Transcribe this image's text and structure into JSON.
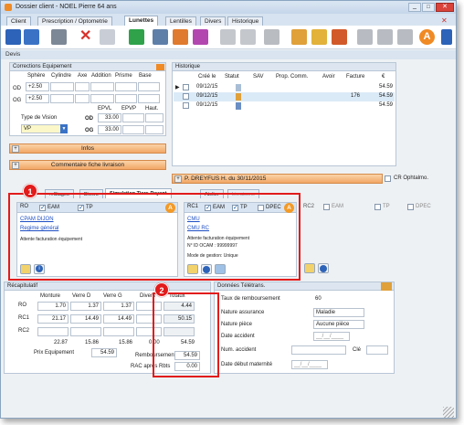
{
  "window": {
    "title": "Dossier client - NOEL Pierre 64 ans"
  },
  "tabs": [
    "Client",
    "Prescription / Optometrie",
    "Lunettes",
    "Lentilles",
    "Divers",
    "Historique"
  ],
  "devis_label": "Devis",
  "corrections": {
    "title": "Corrections Equipement",
    "headers": [
      "Sphère",
      "Cylindre",
      "Axe",
      "Addition",
      "Prisme",
      "Base"
    ],
    "rows": [
      {
        "eye": "OD",
        "sphere": "+2.50"
      },
      {
        "eye": "OG",
        "sphere": "+2.50"
      }
    ],
    "epvl_label": "EPVL",
    "epvp_label": "EPVP",
    "haut_label": "Haut.",
    "type_vision_label": "Type de Vision",
    "type_vision_value": "VP",
    "od_label": "OD",
    "og_label": "OG",
    "od_epvl": "33.00",
    "og_epvl": "33.00"
  },
  "buttons": {
    "infos": "Infos",
    "commentaire": "Commentaire fiche livraison",
    "dreyfus": "P. DREYFUS H. du 30/11/2015",
    "cr_label": "CR Ophtalmo."
  },
  "historique": {
    "title": "Historique",
    "headers": [
      "Créé le",
      "Statut",
      "SAV",
      "Prop. Comm.",
      "Avoir",
      "Facture",
      "€"
    ],
    "rows": [
      {
        "date": "09/12/15",
        "facture": "",
        "amount": "54.59"
      },
      {
        "date": "09/12/15",
        "facture": "176",
        "amount": "54.59"
      },
      {
        "date": "09/12/15",
        "facture": "",
        "amount": "54.59"
      }
    ]
  },
  "subtabs": [
    "...Stages",
    "Divers",
    "Simulation Tiers-Payant",
    "Atelier",
    "Livraisons"
  ],
  "ro": {
    "label": "RO",
    "eam": "EAM",
    "tp": "TP",
    "caisse": "CPAM DIJON",
    "regime": "Regime général",
    "attente": "Attente facturation équipement"
  },
  "rc1": {
    "label": "RC1",
    "eam": "EAM",
    "tp": "TP",
    "dpec": "DPEC",
    "name1": "CMU",
    "name2": "CMU RC",
    "attente": "Attente facturation équipement",
    "ocam": "N° ID OCAM : 99999997",
    "gestion": "Mode de gestion: Unique"
  },
  "rc2": {
    "label": "RC2",
    "eam": "EAM",
    "tp": "TP",
    "dpec": "DPEC"
  },
  "recap": {
    "title": "Récapitulatif",
    "headers": [
      "Monture",
      "Verre D",
      "Verre G",
      "Divers",
      "Totaux"
    ],
    "rows": [
      {
        "label": "RO",
        "values": [
          "1.70",
          "1.37",
          "1.37",
          "",
          "4.44"
        ]
      },
      {
        "label": "RC1",
        "values": [
          "21.17",
          "14.49",
          "14.49",
          "",
          "50.15"
        ]
      },
      {
        "label": "RC2",
        "values": [
          "",
          "",
          "",
          "",
          ""
        ]
      }
    ],
    "totals": [
      "22.87",
      "15.86",
      "15.86",
      "0.00",
      "54.59"
    ],
    "prix_label": "Prix Equipement",
    "prix_value": "54.59",
    "remb_label": "Remboursement estimé",
    "remb_value": "54.59",
    "rac_label": "RAC après Rbts",
    "rac_value": "0.00"
  },
  "teletrans": {
    "title": "Données Télétrans.",
    "taux_label": "Taux de remboursement",
    "taux_value": "60",
    "nature_assurance_label": "Nature assurance",
    "nature_assurance_value": "Maladie",
    "nature_piece_label": "Nature pièce",
    "nature_piece_value": "Aucune pièce",
    "date_accident_label": "Date accident",
    "date_placeholder": "__/__/____",
    "num_accident_label": "Num. accident",
    "cle_label": "Clé",
    "date_maternite_label": "Date début maternité"
  },
  "badges": [
    "1",
    "2"
  ],
  "colors": {
    "accent_orange": "#f2a765",
    "annotation_red": "#e21b1b",
    "badge_orange": "#f39a27"
  }
}
